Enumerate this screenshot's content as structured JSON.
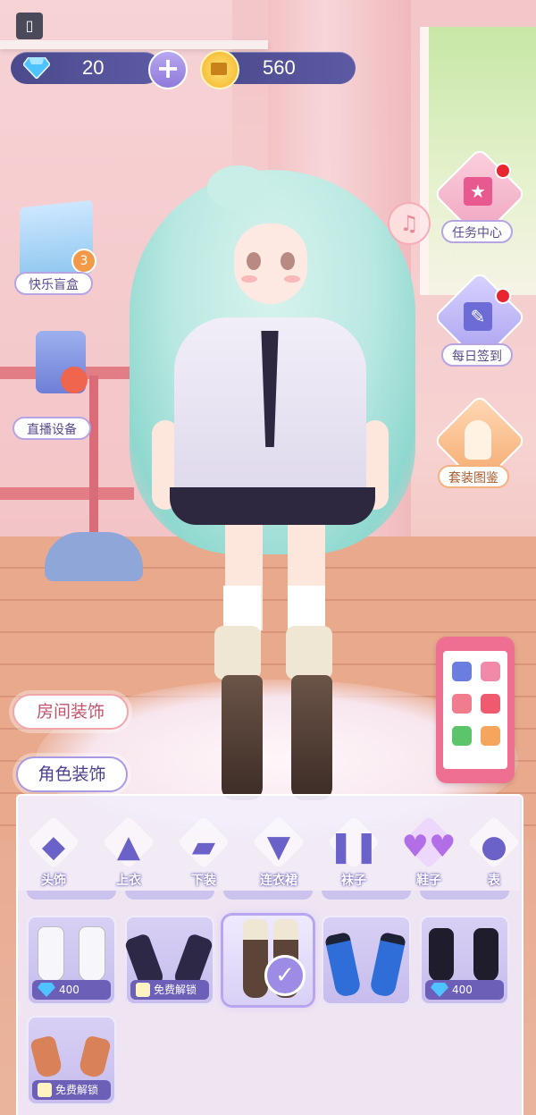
{
  "currency": {
    "gems": "20",
    "gold": "560"
  },
  "side_buttons": {
    "blind_box": "快乐盲盒",
    "blind_box_count": "3",
    "live_equipment": "直播设备",
    "task_center": "任务中心",
    "daily_checkin": "每日签到",
    "outfit_gallery": "套装图鉴"
  },
  "deco_tabs": {
    "room": "房间装饰",
    "character": "角色装饰"
  },
  "categories": [
    {
      "label": "头饰",
      "icon": "hat-icon"
    },
    {
      "label": "上衣",
      "icon": "jacket-icon"
    },
    {
      "label": "下装",
      "icon": "skirt-icon"
    },
    {
      "label": "连衣裙",
      "icon": "dress-icon"
    },
    {
      "label": "袜子",
      "icon": "socks-icon"
    },
    {
      "label": "鞋子",
      "icon": "shoes-icon",
      "active": true
    },
    {
      "label": "表",
      "icon": "accessory-icon"
    }
  ],
  "items": [
    {
      "name": "white-lace-shoes",
      "price": "400",
      "currency": "gem"
    },
    {
      "name": "navy-strap-shoes",
      "price": "免费解锁",
      "currency": "free"
    },
    {
      "name": "brown-fur-boots",
      "selected": true
    },
    {
      "name": "blue-bow-shoes"
    },
    {
      "name": "black-cat-shoes",
      "price": "400",
      "currency": "gem"
    },
    {
      "name": "orange-strap-shoes",
      "price": "免费解锁",
      "currency": "free"
    }
  ],
  "colors": {
    "panel_accent": "#6c5fb8",
    "gem": "#4fc3ff",
    "gold": "#f3b321",
    "alert_dot": "#e8262f"
  }
}
